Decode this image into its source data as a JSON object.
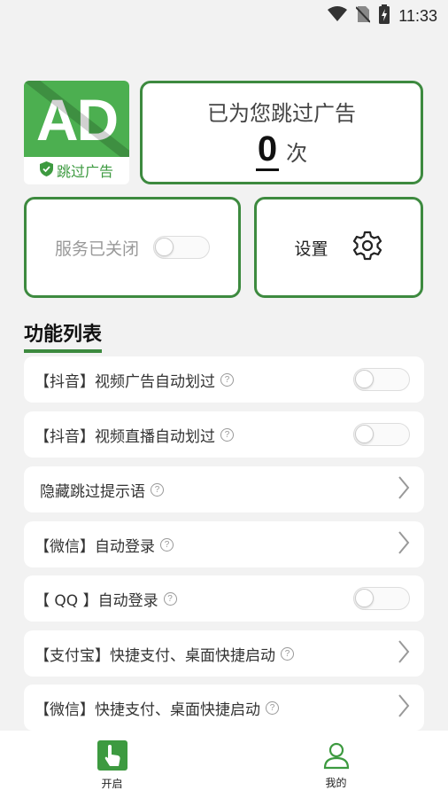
{
  "status_bar": {
    "time": "11:33",
    "icons": [
      "wifi-icon",
      "no-sim-icon",
      "battery-charging-icon"
    ]
  },
  "ad_logo": {
    "text": "AD",
    "skip_label": "跳过广告",
    "badge_icon": "shield-check-icon",
    "colors": {
      "brand_green": "#4caf50",
      "label_green": "#3d9a40"
    }
  },
  "count_card": {
    "title": "已为您跳过广告",
    "count": "0",
    "unit": "次"
  },
  "service_card": {
    "label": "服务已关闭",
    "enabled": false
  },
  "settings_card": {
    "label": "设置",
    "icon": "gear-icon"
  },
  "section": {
    "title": "功能列表"
  },
  "features": [
    {
      "label": "【抖音】视频广告自动划过",
      "control": "toggle",
      "enabled": false
    },
    {
      "label": "【抖音】视频直播自动划过",
      "control": "toggle",
      "enabled": false
    },
    {
      "label": "隐藏跳过提示语",
      "control": "chevron"
    },
    {
      "label": "【微信】自动登录",
      "control": "chevron"
    },
    {
      "label": "【 QQ 】自动登录",
      "control": "toggle",
      "enabled": false
    },
    {
      "label": "【支付宝】快捷支付、桌面快捷启动",
      "control": "chevron"
    },
    {
      "label": "【微信】快捷支付、桌面快捷启动",
      "control": "chevron"
    }
  ],
  "bottom_nav": {
    "items": [
      {
        "label": "开启",
        "icon": "tap-hand-icon",
        "active": true
      },
      {
        "label": "我的",
        "icon": "user-icon",
        "active": false
      }
    ]
  },
  "colors": {
    "accent": "#3d8a3f",
    "background": "#f2f2f2"
  }
}
